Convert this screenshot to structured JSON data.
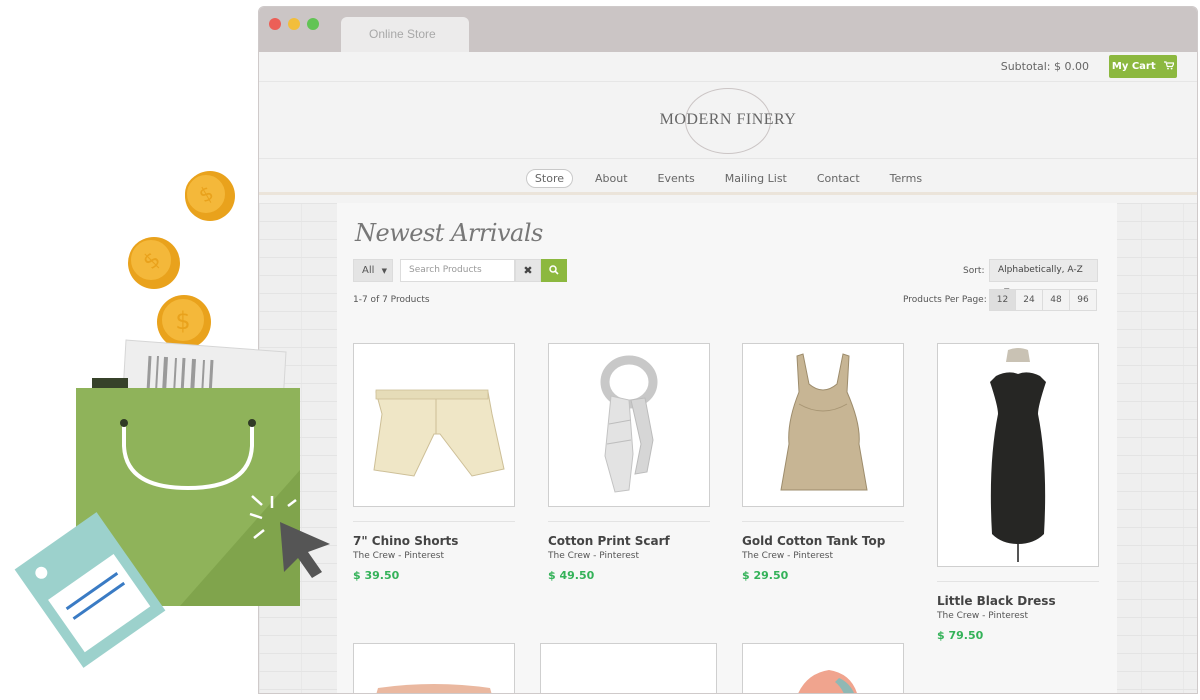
{
  "browser": {
    "tab_title": "Online Store"
  },
  "header": {
    "subtotal": "Subtotal: $ 0.00",
    "cart_label": "My Cart",
    "logo_text": "MODERN FINERY"
  },
  "nav": {
    "items": [
      "Store",
      "About",
      "Events",
      "Mailing List",
      "Contact",
      "Terms"
    ],
    "active": "Store"
  },
  "main": {
    "heading": "Newest Arrivals",
    "filter_value": "All",
    "search_placeholder": "Search Products",
    "product_count": "1-7 of 7 Products",
    "sort_label": "Sort:",
    "sort_value": "Alphabetically, A-Z",
    "per_page_label": "Products Per Page:",
    "per_page_options": [
      "12",
      "24",
      "48",
      "96"
    ],
    "per_page_selected": "12"
  },
  "products": [
    {
      "name": "7\" Chino Shorts",
      "vendor": "The Crew - Pinterest",
      "price": "$ 39.50"
    },
    {
      "name": "Cotton Print Scarf",
      "vendor": "The Crew - Pinterest",
      "price": "$ 49.50"
    },
    {
      "name": "Gold Cotton Tank Top",
      "vendor": "The Crew - Pinterest",
      "price": "$ 29.50"
    },
    {
      "name": "Little Black Dress",
      "vendor": "The Crew - Pinterest",
      "price": "$ 79.50"
    }
  ],
  "colors": {
    "accent": "#8cb83f",
    "price": "#34b259"
  },
  "icons": [
    "cart-icon",
    "clear-icon",
    "search-icon",
    "caret-down-icon"
  ]
}
